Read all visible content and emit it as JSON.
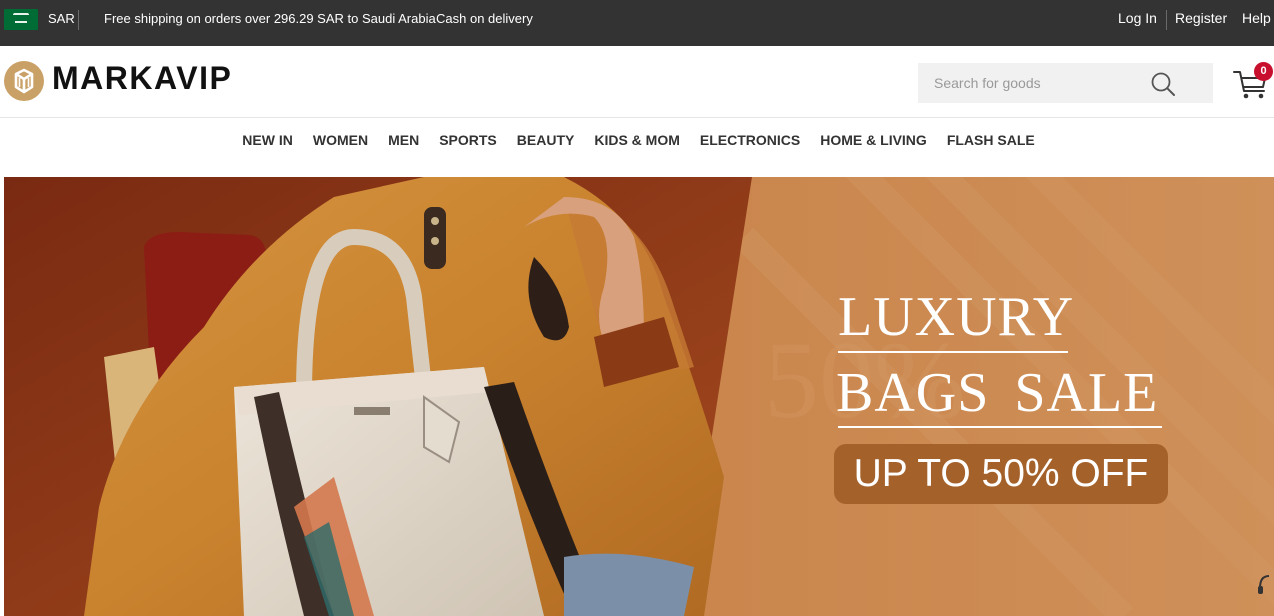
{
  "topbar": {
    "currency": "SAR",
    "shipping_text": "Free shipping on orders over 296.29 SAR to Saudi Arabia",
    "cod_text": "Cash on delivery",
    "login": "Log In",
    "register": "Register",
    "help": "Help"
  },
  "header": {
    "logo_text": "MARKAVIP",
    "search_placeholder": "Search for goods",
    "cart_count": "0"
  },
  "nav": {
    "items": [
      "NEW IN",
      "WOMEN",
      "MEN",
      "SPORTS",
      "BEAUTY",
      "KIDS & MOM",
      "ELECTRONICS",
      "HOME & LIVING",
      "FLASH SALE"
    ]
  },
  "banner": {
    "title_line1": "LUXURY",
    "title_line2": "BAGS  SALE",
    "badge": "UP TO 50% OFF"
  },
  "colors": {
    "topbar_bg": "#333333",
    "logo_gold": "#c9a167",
    "badge_red": "#c8102e",
    "banner_orange": "#c78548",
    "banner_badge": "#a5612a"
  },
  "icons": {
    "flag": "saudi-flag-icon",
    "logo": "markavip-logo-icon",
    "search": "search-icon",
    "cart": "cart-icon"
  }
}
